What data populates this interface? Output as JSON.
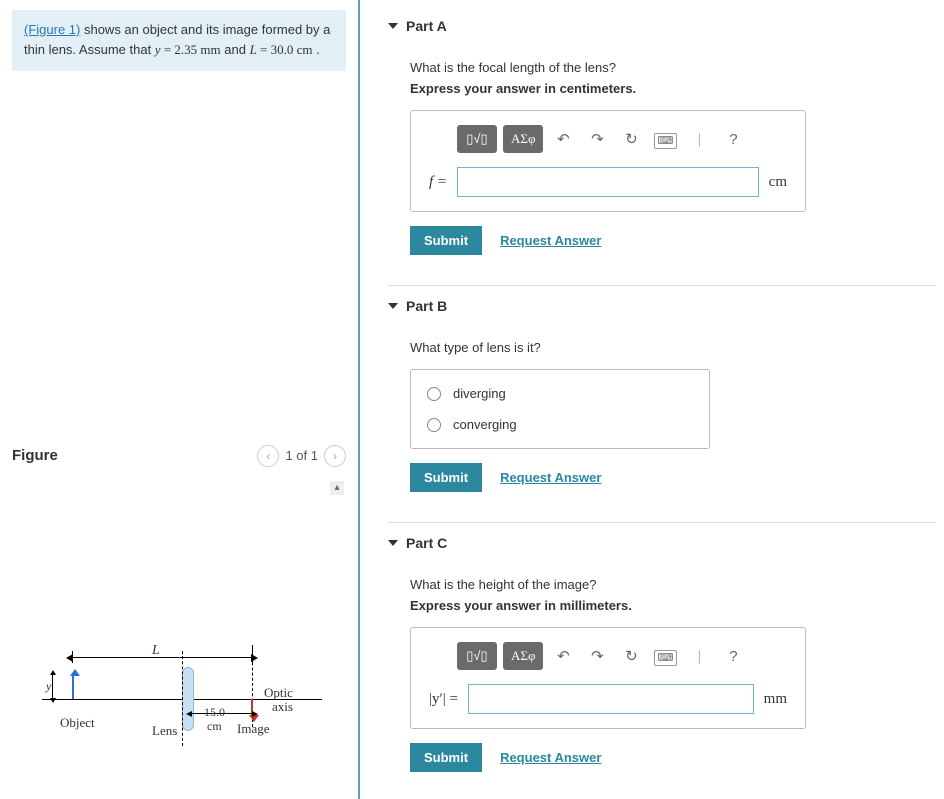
{
  "problem": {
    "figure_link": "(Figure 1)",
    "intro_1": " shows an object and its image formed by a thin lens. Assume that ",
    "y_var": "y",
    "eq1": " = 2.35 mm",
    "and": " and ",
    "L_var": "L",
    "eq2": " = 30.0 cm",
    "period": " ."
  },
  "figure_panel": {
    "title": "Figure",
    "pager": "1 of 1",
    "labels": {
      "y": "y",
      "L": "L",
      "dist_num": "15.0",
      "dist_unit": "cm",
      "object": "Object",
      "lens": "Lens",
      "image": "Image",
      "optic": "Optic",
      "axis": "axis"
    }
  },
  "toolbar": {
    "frac": "▯√▯",
    "greek": "ΑΣφ",
    "undo": "↶",
    "redo": "↷",
    "reset": "↻",
    "kbd": "⌨",
    "bar": "|",
    "help": "?"
  },
  "actions": {
    "submit": "Submit",
    "request": "Request Answer"
  },
  "parts": {
    "a": {
      "header": "Part A",
      "prompt": "What is the focal length of the lens?",
      "instruct": "Express your answer in centimeters.",
      "var": "f =",
      "unit": "cm"
    },
    "b": {
      "header": "Part B",
      "prompt": "What type of lens is it?",
      "opt1": "diverging",
      "opt2": "converging"
    },
    "c": {
      "header": "Part C",
      "prompt": "What is the height of the image?",
      "instruct": "Express your answer in millimeters.",
      "var": "|y′| =",
      "unit": "mm"
    }
  }
}
